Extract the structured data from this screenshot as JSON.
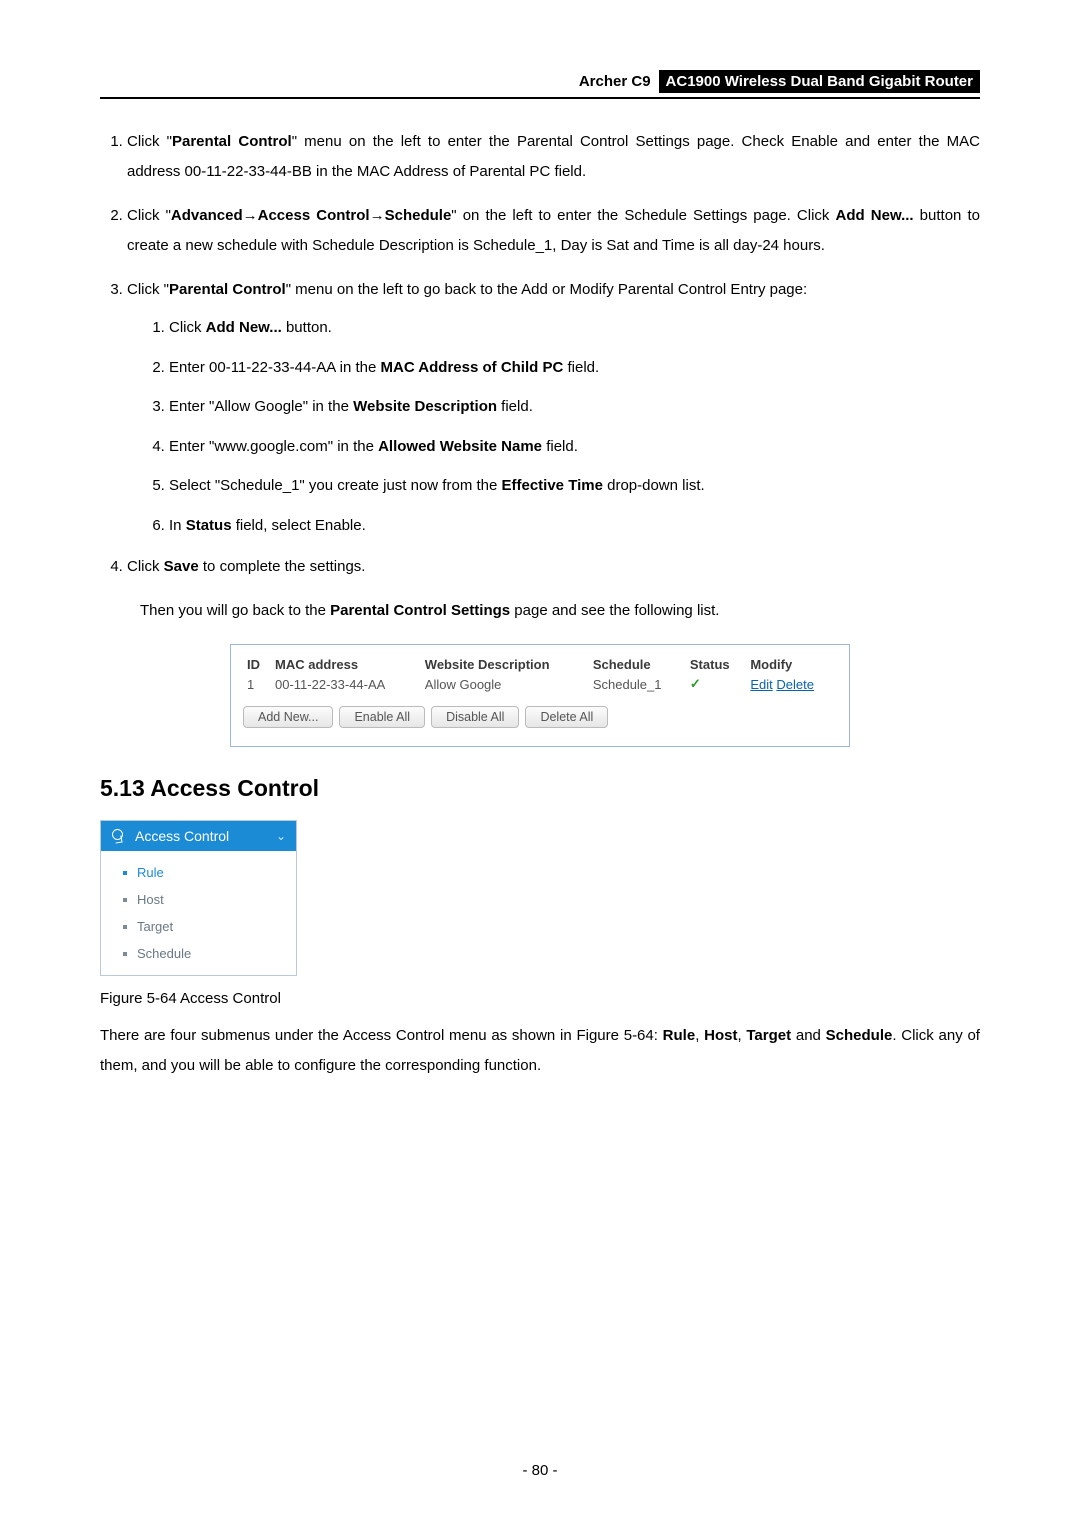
{
  "header": {
    "model": "Archer C9",
    "title": "AC1900 Wireless Dual Band Gigabit Router"
  },
  "steps": {
    "s1_a": "Click \"",
    "s1_b": "Parental Control",
    "s1_c": "\" menu on the left to enter the Parental Control Settings page. Check Enable and enter the MAC address 00-11-22-33-44-BB in the MAC Address of Parental PC field.",
    "s2_a": "Click \"",
    "s2_b": "Advanced",
    "s2_arrow1": "→",
    "s2_c": "Access Control",
    "s2_arrow2": "→",
    "s2_d": "Schedule",
    "s2_e": "\" on the left to enter the Schedule Settings page. Click ",
    "s2_f": "Add New...",
    "s2_g": " button to create a new schedule with Schedule Description is Schedule_1, Day is Sat and Time is all day-24 hours.",
    "s3_a": "Click \"",
    "s3_b": "Parental Control",
    "s3_c": "\" menu on the left to go back to the Add or Modify Parental Control Entry page:",
    "sub1_a": "Click ",
    "sub1_b": "Add New...",
    "sub1_c": " button.",
    "sub2_a": "Enter 00-11-22-33-44-AA in the ",
    "sub2_b": "MAC Address of Child PC",
    "sub2_c": " field.",
    "sub3_a": "Enter \"Allow Google\" in the ",
    "sub3_b": "Website Description",
    "sub3_c": " field.",
    "sub4_a": "Enter \"www.google.com\" in the ",
    "sub4_b": "Allowed Website Name",
    "sub4_c": " field.",
    "sub5_a": "Select \"Schedule_1\" you create just now from the ",
    "sub5_b": "Effective Time",
    "sub5_c": " drop-down list.",
    "sub6_a": "In ",
    "sub6_b": "Status",
    "sub6_c": " field, select Enable.",
    "s4_a": "Click ",
    "s4_b": "Save",
    "s4_c": " to complete the settings.",
    "then_a": "Then you will go back to the ",
    "then_b": "Parental Control Settings",
    "then_c": " page and see the following list."
  },
  "table": {
    "headers": {
      "id": "ID",
      "mac": "MAC address",
      "desc": "Website Description",
      "sched": "Schedule",
      "status": "Status",
      "modify": "Modify"
    },
    "row": {
      "id": "1",
      "mac": "00-11-22-33-44-AA",
      "desc": "Allow Google",
      "sched": "Schedule_1",
      "status_icon": "✓",
      "edit": "Edit",
      "delete": "Delete"
    },
    "buttons": {
      "add": "Add New...",
      "enable": "Enable All",
      "disable": "Disable All",
      "delete": "Delete All"
    }
  },
  "section": {
    "heading": "5.13  Access Control"
  },
  "menu": {
    "title": "Access Control",
    "items": [
      "Rule",
      "Host",
      "Target",
      "Schedule"
    ]
  },
  "figure": {
    "caption": "Figure 5-64 Access Control"
  },
  "para": {
    "a": "There are four submenus under the Access Control menu as shown in Figure 5-64: ",
    "b": "Rule",
    "c": ", ",
    "d": "Host",
    "e": ", ",
    "f": "Target",
    "g": " and ",
    "h": "Schedule",
    "i": ". Click any of them, and you will be able to configure the corresponding function."
  },
  "page_num": "- 80 -"
}
